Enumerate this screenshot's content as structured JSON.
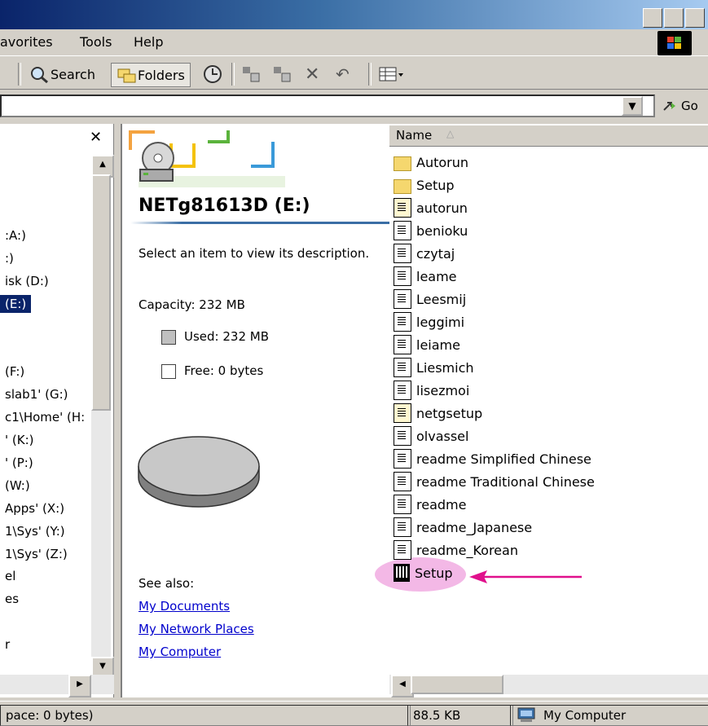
{
  "menu": {
    "favorites": "avorites",
    "tools": "Tools",
    "help": "Help"
  },
  "toolbar": {
    "search": "Search",
    "folders": "Folders"
  },
  "address": {
    "go": "Go"
  },
  "tree": [
    ":A:)",
    ":)",
    "isk (D:)",
    "(E:)",
    "(F:)",
    "slab1' (G:)",
    "c1\\Home' (H:",
    "' (K:)",
    "' (P:)",
    "(W:)",
    "Apps' (X:)",
    "1\\Sys' (Y:)",
    "1\\Sys' (Z:)",
    "el",
    "es",
    "r"
  ],
  "info": {
    "drive_title": "NETg81613D (E:)",
    "select_prompt": "Select an item to view its description.",
    "capacity": "Capacity: 232 MB",
    "used": "Used: 232 MB",
    "free": "Free: 0 bytes",
    "see_also": "See also:",
    "links": [
      "My Documents",
      "My Network Places",
      "My Computer"
    ],
    "colors": {
      "used": "#c0c0c0",
      "link": "#0000cc"
    }
  },
  "files": {
    "column_name": "Name",
    "items": [
      {
        "name": "Autorun",
        "icon": "folder-icon"
      },
      {
        "name": "Setup",
        "icon": "folder-icon"
      },
      {
        "name": "autorun",
        "icon": "settings-file-icon"
      },
      {
        "name": "benioku",
        "icon": "text-file-icon"
      },
      {
        "name": "czytaj",
        "icon": "text-file-icon"
      },
      {
        "name": "leame",
        "icon": "text-file-icon"
      },
      {
        "name": "Leesmij",
        "icon": "text-file-icon"
      },
      {
        "name": "leggimi",
        "icon": "text-file-icon"
      },
      {
        "name": "leiame",
        "icon": "text-file-icon"
      },
      {
        "name": "Liesmich",
        "icon": "text-file-icon"
      },
      {
        "name": "lisezmoi",
        "icon": "text-file-icon"
      },
      {
        "name": "netgsetup",
        "icon": "settings-file-icon"
      },
      {
        "name": "olvassel",
        "icon": "text-file-icon"
      },
      {
        "name": "readme Simplified Chinese",
        "icon": "text-file-icon"
      },
      {
        "name": "readme Traditional Chinese",
        "icon": "text-file-icon"
      },
      {
        "name": "readme",
        "icon": "text-file-icon"
      },
      {
        "name": "readme_Japanese",
        "icon": "text-file-icon"
      },
      {
        "name": "readme_Korean",
        "icon": "text-file-icon"
      },
      {
        "name": "Setup",
        "icon": "setup-exe-icon",
        "highlighted": true
      }
    ],
    "highlight_color": "#f3b8e6",
    "arrow_color": "#e0108c"
  },
  "status": {
    "left": "pace: 0 bytes)",
    "size": "88.5 KB",
    "zone": "My Computer"
  }
}
